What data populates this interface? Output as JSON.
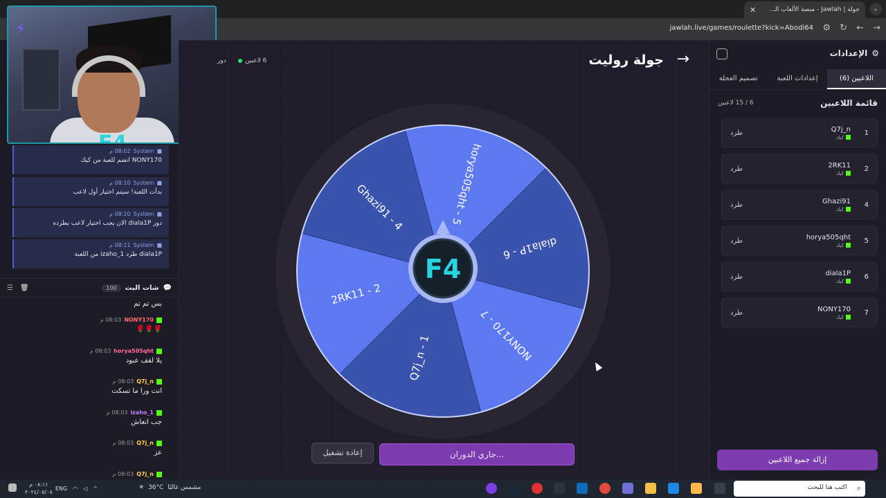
{
  "browser": {
    "tab_title": "جولة | Jawlah - منصة الألعاب الـ..",
    "tab_close": "✕",
    "new_tab": "+",
    "url": "jawlah.live/games/roulette?kick=Abodi64"
  },
  "webcam": {
    "logo": "F4",
    "bolt": "⚡"
  },
  "system_messages": [
    {
      "sender": "System",
      "time": "08:02 م",
      "text": "NONY170 انضم للعبة من كيك"
    },
    {
      "sender": "System",
      "time": "08:10 م",
      "text": "بدأت اللعبة! سيتم اختيار أول لاعب"
    },
    {
      "sender": "System",
      "time": "08:10 م",
      "text": "دور diala1P الان يجب اختيار لاعب يطرده"
    },
    {
      "sender": "System",
      "time": "08:11 م",
      "text": "diala1P طرد izaho_1 من اللعبة"
    }
  ],
  "chat": {
    "title": "شات البث",
    "count": "100",
    "partial_text": "بس تم تم",
    "messages": [
      {
        "user": "NONY170",
        "time": "08:03 م",
        "text": "🌹🌹🌹",
        "color": "#ff6b6b"
      },
      {
        "user": "horya505qht",
        "time": "08:03 م",
        "text": "يلا لقف عبود",
        "color": "#ff6b9a"
      },
      {
        "user": "Q7j_n",
        "time": "08:03 م",
        "text": "انت ورا ما تسكت",
        "color": "#ffd34d"
      },
      {
        "user": "izaho_1",
        "time": "08:03 م",
        "text": "جب انعاش",
        "color": "#c77dff"
      },
      {
        "user": "Q7j_n",
        "time": "08:03 م",
        "text": "عز",
        "color": "#ffd34d"
      },
      {
        "user": "Q7j_n",
        "time": "08:03 م",
        "text": "",
        "color": "#ffd34d"
      }
    ]
  },
  "game": {
    "title": "جولة روليت",
    "back_arrow": "→",
    "players_count": "6 لاعبين",
    "turn_label": "دور",
    "replay_button": "إعادة تشغيل",
    "spinning_button": "جاري الدوران...",
    "center_logo": "F4",
    "segments": [
      {
        "label": "horya505qht - 5",
        "color": "#5c79f0"
      },
      {
        "label": "diala1P - 6",
        "color": "#3a53ad"
      },
      {
        "label": "NONY170 - 7",
        "color": "#5c79f0"
      },
      {
        "label": "Q7j_n - 1",
        "color": "#3a53ad"
      },
      {
        "label": "2RK11 - 2",
        "color": "#5c79f0"
      },
      {
        "label": "Ghazi91 - 4",
        "color": "#3a53ad"
      }
    ]
  },
  "settings": {
    "title": "الإعدادات",
    "tabs": [
      "اللاعبين (6)",
      "إعدادات اللعبة",
      "تصميم العجلة"
    ],
    "list_title": "قائمة اللاعبين",
    "list_count": "6 / 15 لاعبين",
    "kick_label": "طرد",
    "platform": "كيك",
    "players": [
      {
        "num": "1",
        "name": "Q7j_n"
      },
      {
        "num": "2",
        "name": "2RK11"
      },
      {
        "num": "4",
        "name": "Ghazi91"
      },
      {
        "num": "5",
        "name": "horya505qht"
      },
      {
        "num": "6",
        "name": "diala1P"
      },
      {
        "num": "7",
        "name": "NONY170"
      }
    ],
    "clear_button": "إزالة جميع اللاعبين"
  },
  "taskbar": {
    "search_placeholder": "اكتب هنا للبحث",
    "weather_temp": "36°C",
    "weather_desc": "مشمس غالبًا",
    "lang": "ENG",
    "time": "٠٨:١١ م",
    "date": "٢٠٢٤/٠٥/٠٨"
  }
}
